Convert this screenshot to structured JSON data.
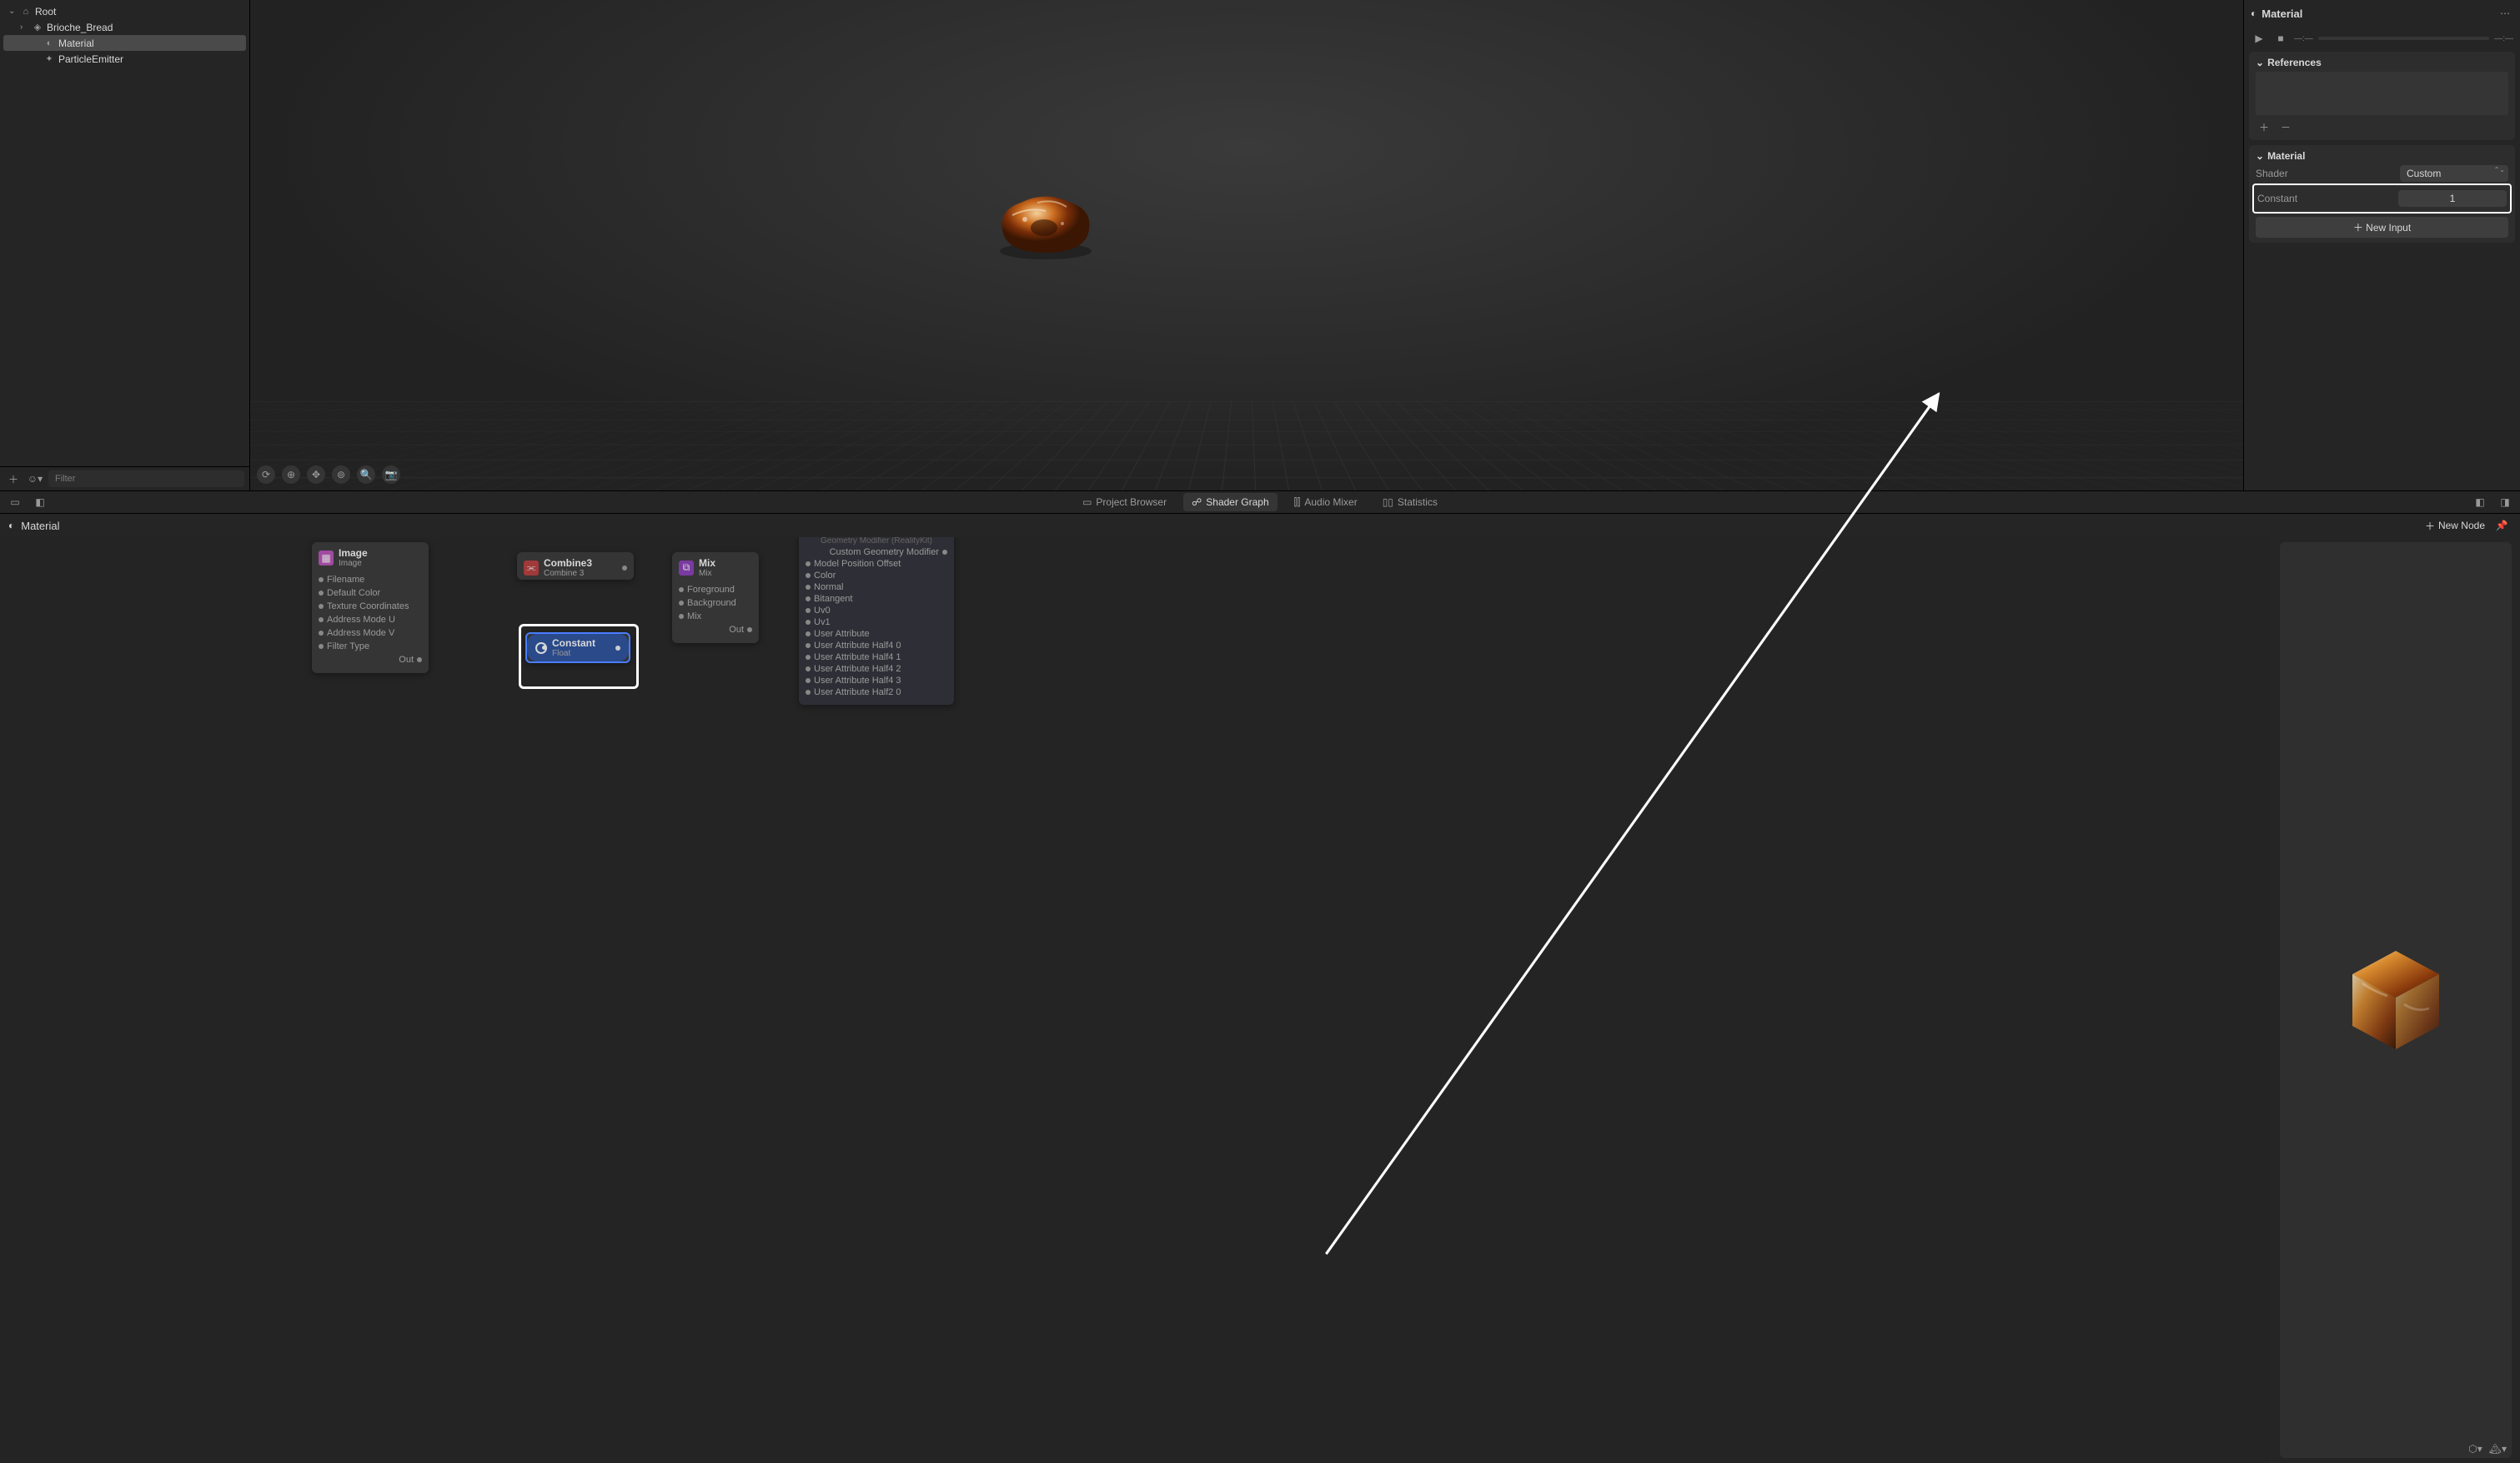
{
  "hierarchy": {
    "root": "Root",
    "items": [
      {
        "label": "Brioche_Bread",
        "depth": 1,
        "expandable": true
      },
      {
        "label": "Material",
        "depth": 2,
        "selected": true
      },
      {
        "label": "ParticleEmitter",
        "depth": 2
      }
    ],
    "filter_placeholder": "Filter"
  },
  "inspector": {
    "title": "Material",
    "timeline": {
      "start": "—:—",
      "end": "—:—"
    },
    "references": {
      "title": "References"
    },
    "material": {
      "title": "Material",
      "shader_label": "Shader",
      "shader_value": "Custom",
      "constant_label": "Constant",
      "constant_value": "1",
      "new_input": "New Input"
    }
  },
  "tabs": {
    "project_browser": "Project Browser",
    "shader_graph": "Shader Graph",
    "audio_mixer": "Audio Mixer",
    "statistics": "Statistics"
  },
  "graph": {
    "breadcrumb": "Material",
    "image_node": {
      "title": "Image",
      "subtitle": "Image",
      "ports": [
        "Filename",
        "Default Color",
        "Texture Coordinates",
        "Address Mode U",
        "Address Mode V",
        "Filter Type"
      ],
      "out": "Out"
    },
    "combine_node": {
      "title": "Combine3",
      "subtitle": "Combine 3"
    },
    "constant_node": {
      "title": "Constant",
      "subtitle": "Float"
    },
    "mix_node": {
      "title": "Mix",
      "subtitle": "Mix",
      "ins": [
        "Foreground",
        "Background",
        "Mix"
      ],
      "out": "Out"
    },
    "output_node": {
      "top_hint": "Geometry Modifier (RealityKit)",
      "ports": [
        "Custom Geometry Modifier",
        "Model Position Offset",
        "Color",
        "Normal",
        "Bitangent",
        "Uv0",
        "Uv1",
        "User Attribute",
        "User Attribute Half4 0",
        "User Attribute Half4 1",
        "User Attribute Half4 2",
        "User Attribute Half4 3",
        "User Attribute Half2 0"
      ]
    },
    "new_node": "New Node"
  }
}
